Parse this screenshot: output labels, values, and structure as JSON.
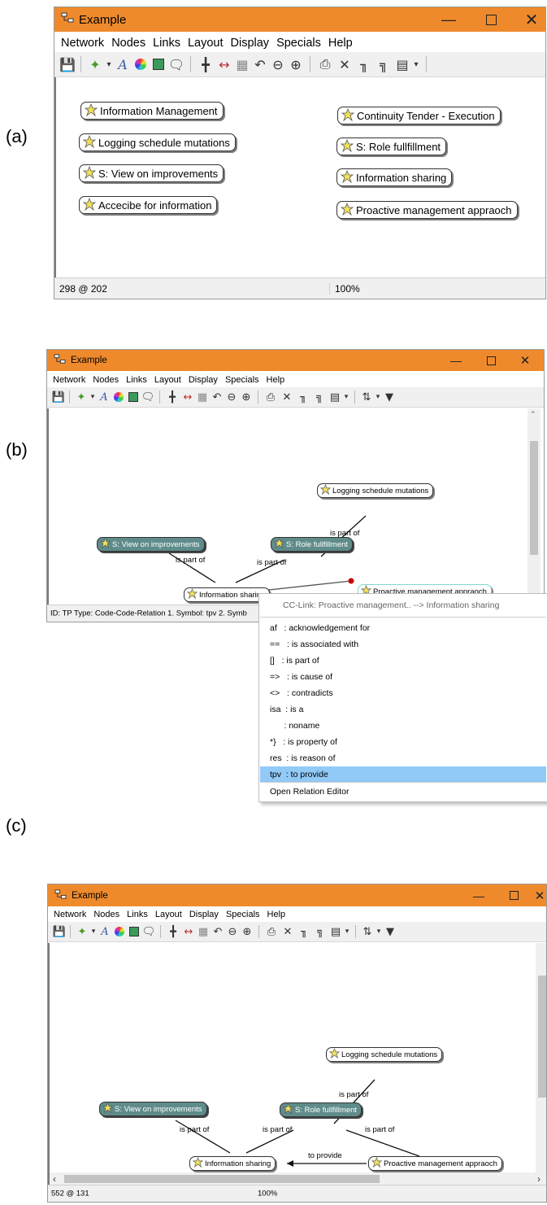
{
  "labels": {
    "a": "(a)",
    "b": "(b)",
    "c": "(c)"
  },
  "window": {
    "title": "Example",
    "menu": [
      "Network",
      "Nodes",
      "Links",
      "Layout",
      "Display",
      "Specials",
      "Help"
    ]
  },
  "panel_a": {
    "nodes": [
      "Information Management",
      "Logging schedule mutations",
      "S: View on improvements",
      "Accecibe for information",
      "Continuity Tender - Execution",
      "S: Role fullfillment",
      "Information sharing",
      "Proactive management appraoch"
    ],
    "status_coords": "298 @ 202",
    "status_zoom": "100%"
  },
  "panel_b": {
    "nodes": {
      "logging": "Logging schedule mutations",
      "view": "S: View on improvements",
      "role": "S: Role fullfillment",
      "sharing": "Information sharing",
      "proactive": "Proactive management appraoch"
    },
    "link_labels": [
      "is part of",
      "is part of",
      "is part of"
    ],
    "status_text": "ID: TP Type: Code-Code-Relation 1. Symbol: tpv 2. Symb",
    "context_menu": {
      "header": "CC-Link: Proactive management.. --> Information sharing",
      "items": [
        "af   : acknowledgement for",
        "==   : is associated with",
        "[]   : is part of",
        "=>   : is cause of",
        "<>   : contradicts",
        "isa  : is a",
        "      : noname",
        "*}   : is property of",
        "res  : is reason of",
        "tpv  : to provide"
      ],
      "selected_index": 9,
      "footer": "Open Relation Editor"
    }
  },
  "panel_c": {
    "nodes": {
      "logging": "Logging schedule mutations",
      "view": "S: View on improvements",
      "role": "S: Role fullfillment",
      "sharing": "Information sharing",
      "proactive": "Proactive management appraoch"
    },
    "link_labels": [
      "is part of",
      "is part of",
      "is part of",
      "is part of",
      "to provide"
    ],
    "status_coords": "552 @ 131",
    "status_zoom": "100%"
  },
  "colors": {
    "titlebar": "#ef8a2c",
    "teal_node": "#5f8c8a",
    "menu_selected": "#91c9f7",
    "anchor": "#cc0000"
  },
  "icons": [
    "network-app-icon",
    "save-icon",
    "new-node-icon",
    "font-icon",
    "color-wheel-icon",
    "node-style-icon",
    "comment-icon",
    "tree-layout-icon",
    "spread-icon",
    "grid-icon",
    "undo-icon",
    "zoom-out-icon",
    "zoom-in-icon",
    "print-icon",
    "delete-icon",
    "link-icon",
    "unlink-icon",
    "display-icon",
    "sort-icon",
    "filter-icon",
    "code-node-icon"
  ]
}
